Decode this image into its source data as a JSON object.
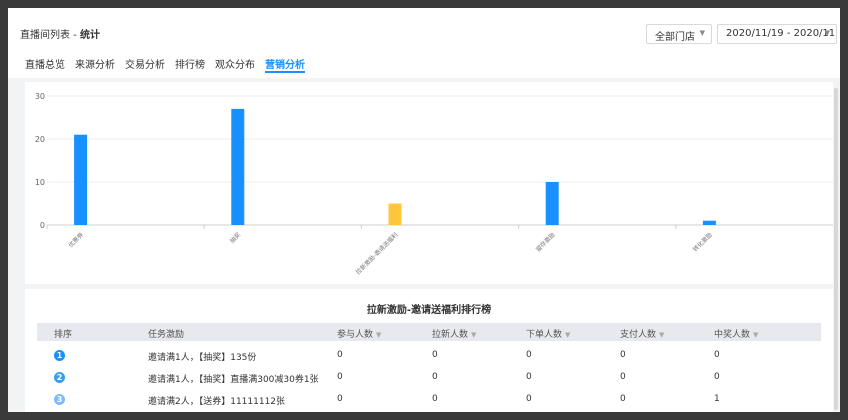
{
  "header": {
    "breadcrumb_parent": "直播间列表",
    "breadcrumb_sep": " - ",
    "breadcrumb_current": "统计",
    "store_select": "全部门店",
    "date_range": "2020/11/19 - 2020/11"
  },
  "tabs": [
    {
      "label": "直播总览"
    },
    {
      "label": "来源分析"
    },
    {
      "label": "交易分析"
    },
    {
      "label": "排行榜"
    },
    {
      "label": "观众分布"
    },
    {
      "label": "营销分析",
      "active": true
    }
  ],
  "chart_data": {
    "type": "bar",
    "categories": [
      "优惠券",
      "抽奖",
      "拉新激励-邀请送福利",
      "留存激励",
      "转化激励"
    ],
    "values": [
      21,
      27,
      5,
      10,
      1
    ],
    "colors": [
      "#1890ff",
      "#1890ff",
      "#ffc53d",
      "#1890ff",
      "#1890ff"
    ],
    "ylim": [
      0,
      30
    ],
    "yticks": [
      0,
      10,
      20,
      30
    ],
    "grid": true
  },
  "table": {
    "title": "拉新激励-邀请送福利排行榜",
    "columns": [
      "排序",
      "任务激励",
      "参与人数",
      "拉新人数",
      "下单人数",
      "支付人数",
      "中奖人数"
    ],
    "rows": [
      {
        "rank": "1",
        "task": "邀请满1人，【抽奖】135份",
        "join": "0",
        "new": "0",
        "order": "0",
        "pay": "0",
        "win": "0"
      },
      {
        "rank": "2",
        "task": "邀请满1人，【抽奖】直播满300减30券1张",
        "join": "0",
        "new": "0",
        "order": "0",
        "pay": "0",
        "win": "0"
      },
      {
        "rank": "3",
        "task": "邀请满2人，【送券】11111112张",
        "join": "0",
        "new": "0",
        "order": "0",
        "pay": "0",
        "win": "1"
      }
    ],
    "rank_colors": [
      "#1890ff",
      "#3a9cf7",
      "#7fbcf7"
    ]
  }
}
